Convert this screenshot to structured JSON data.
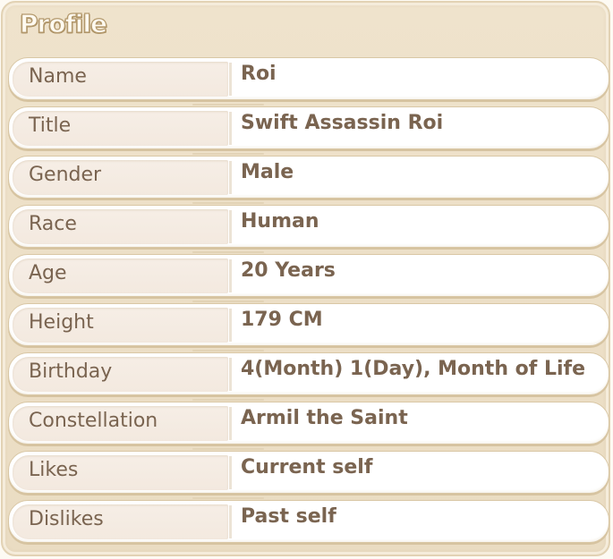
{
  "panel": {
    "title": "Profile"
  },
  "rows": [
    {
      "label": "Name",
      "value": "Roi"
    },
    {
      "label": "Title",
      "value": "Swift Assassin Roi"
    },
    {
      "label": "Gender",
      "value": "Male"
    },
    {
      "label": "Race",
      "value": "Human"
    },
    {
      "label": "Age",
      "value": "20 Years"
    },
    {
      "label": "Height",
      "value": "179 CM"
    },
    {
      "label": "Birthday",
      "value": "4(Month) 1(Day), Month of Life"
    },
    {
      "label": "Constellation",
      "value": "Armil the Saint"
    },
    {
      "label": "Likes",
      "value": "Current self"
    },
    {
      "label": "Dislikes",
      "value": "Past self"
    }
  ],
  "colors": {
    "panel_background": "#eadcc2",
    "label_background": "#f4ebe2",
    "row_background": "#ffffff",
    "text": "#7a6450",
    "title_fill": "#fffaf0",
    "title_outline": "#b49a6e"
  }
}
